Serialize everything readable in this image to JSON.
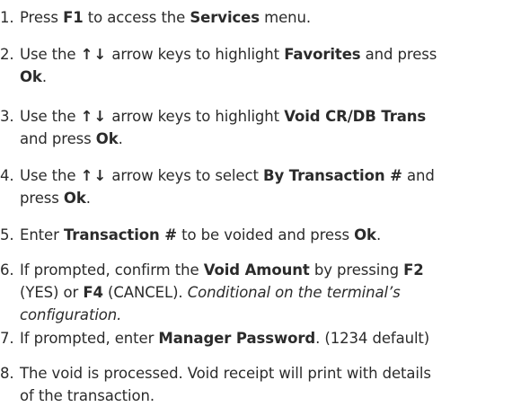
{
  "steps": [
    {
      "number": "1.",
      "parts": [
        {
          "t": "Press "
        },
        {
          "t": "F1",
          "b": true
        },
        {
          "t": " to access the "
        },
        {
          "t": "Services",
          "b": true
        },
        {
          "t": " menu."
        }
      ]
    },
    {
      "number": "2.",
      "parts": [
        {
          "t": "Use the "
        },
        {
          "t": "↑↓",
          "arrows": true
        },
        {
          "t": " arrow keys to highlight "
        },
        {
          "t": "Favorites",
          "b": true
        },
        {
          "t": " and press "
        },
        {
          "br": true
        },
        {
          "t": "Ok",
          "b": true
        },
        {
          "t": "."
        }
      ]
    },
    {
      "number": "3.",
      "parts": [
        {
          "t": "Use the "
        },
        {
          "t": "↑↓",
          "arrows": true
        },
        {
          "t": " arrow keys to highlight "
        },
        {
          "t": "Void CR/DB Trans",
          "b": true
        },
        {
          "br": true
        },
        {
          "t": "and press "
        },
        {
          "t": "Ok",
          "b": true
        },
        {
          "t": "."
        }
      ]
    },
    {
      "number": "4.",
      "parts": [
        {
          "t": "Use the "
        },
        {
          "t": "↑↓",
          "arrows": true
        },
        {
          "t": " arrow keys to select "
        },
        {
          "t": "By Transaction #",
          "b": true
        },
        {
          "t": " and "
        },
        {
          "br": true
        },
        {
          "t": "press "
        },
        {
          "t": "Ok",
          "b": true
        },
        {
          "t": "."
        }
      ]
    },
    {
      "number": "5.",
      "parts": [
        {
          "t": "Enter "
        },
        {
          "t": "Transaction #",
          "b": true
        },
        {
          "t": " to be voided and press "
        },
        {
          "t": "Ok",
          "b": true
        },
        {
          "t": "."
        }
      ]
    },
    {
      "number": "6.",
      "parts": [
        {
          "t": "If prompted, confirm the "
        },
        {
          "t": "Void Amount",
          "b": true
        },
        {
          "t": " by pressing "
        },
        {
          "t": "F2",
          "b": true
        },
        {
          "br": true
        },
        {
          "t": "(YES) or "
        },
        {
          "t": "F4",
          "b": true
        },
        {
          "t": " (CANCEL). "
        },
        {
          "t": "Conditional on the terminal’s",
          "i": true
        },
        {
          "br": true
        },
        {
          "t": "configuration.",
          "i": true
        }
      ]
    },
    {
      "number": "7.",
      "parts": [
        {
          "t": "If prompted, enter "
        },
        {
          "t": "Manager Password",
          "b": true
        },
        {
          "t": ". (1234 default)"
        }
      ]
    },
    {
      "number": "8.",
      "parts": [
        {
          "t": "The void is processed. Void receipt will print with details"
        },
        {
          "br": true
        },
        {
          "t": "of the transaction."
        }
      ]
    }
  ]
}
